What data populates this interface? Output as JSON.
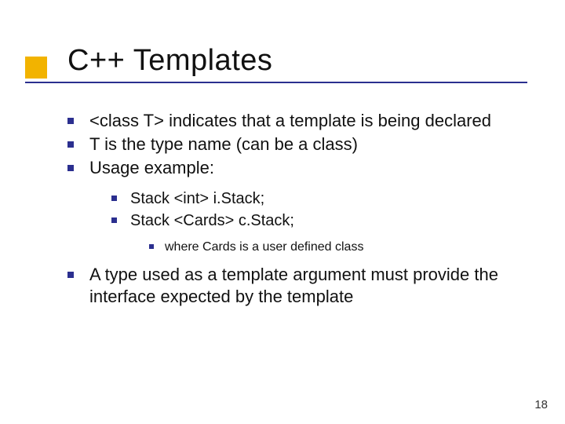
{
  "title": "C++ Templates",
  "bullets": [
    "<class T> indicates that a template is being declared",
    "T is the type name (can be a class)",
    "Usage example:"
  ],
  "sub_bullets": [
    "Stack <int> i.Stack;",
    "Stack <Cards> c.Stack;"
  ],
  "sub_sub_bullets": [
    "where Cards is a user defined class"
  ],
  "bullets2": [
    "A type used as a template argument must provide the interface expected by the template"
  ],
  "page_number": "18"
}
